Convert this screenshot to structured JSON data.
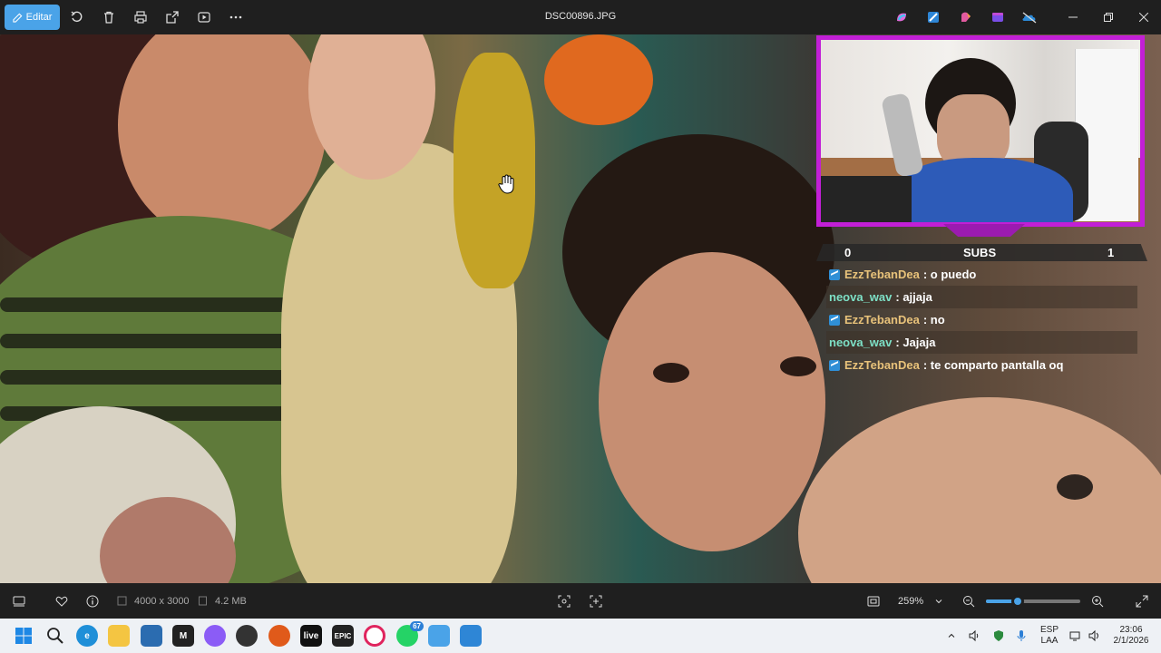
{
  "toolbar": {
    "edit_label": "Editar",
    "title": "DSC00896.JPG",
    "icons": [
      "rotate-icon",
      "delete-icon",
      "print-icon",
      "share-icon",
      "slideshow-icon",
      "more-icon"
    ],
    "app_icons": [
      "copilot-icon",
      "photos-edit-icon",
      "paint-icon",
      "clipchamp-icon",
      "onedrive-icon"
    ]
  },
  "overlay": {
    "subs_left": "0",
    "subs_label": "SUBS",
    "subs_right": "1",
    "chat": [
      {
        "name": "EzzTebanDea",
        "msg": ": o puedo",
        "badge": true
      },
      {
        "name": "neova_wav",
        "msg": ": ajjaja",
        "badge": false
      },
      {
        "name": "EzzTebanDea",
        "msg": ": no",
        "badge": true
      },
      {
        "name": "neova_wav",
        "msg": ": Jajaja",
        "badge": false
      },
      {
        "name": "EzzTebanDea",
        "msg": ": te comparto pantalla oq",
        "badge": true
      }
    ]
  },
  "infobar": {
    "dimensions": "4000 x 3000",
    "filesize": "4.2 MB",
    "zoom": "259%",
    "zoom_slider_fraction": 0.34
  },
  "taskbar": {
    "badge_count": "67",
    "lang_line1": "ESP",
    "lang_line2": "LAA",
    "time": "23:06",
    "date": "2/1/2026"
  },
  "colors": {
    "accent": "#4aa3e8",
    "stream_frame": "#c21fd6",
    "name_color_1": "#e8c27a",
    "name_color_2": "#7de0c6"
  }
}
